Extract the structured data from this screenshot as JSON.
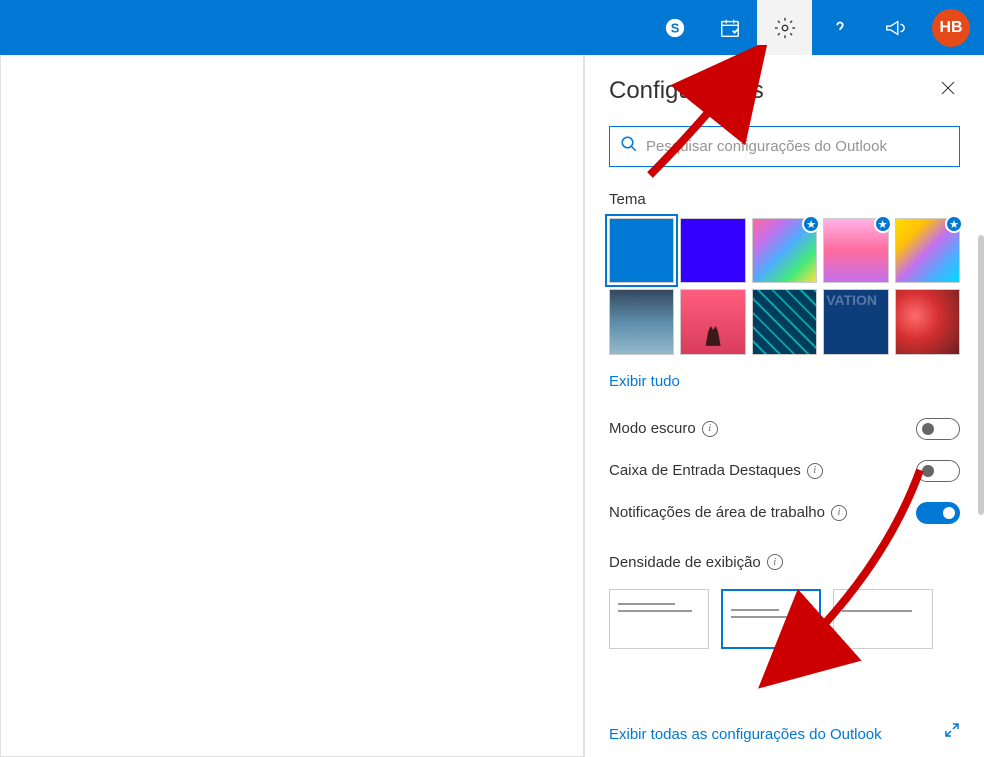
{
  "header": {
    "avatar_initials": "HB"
  },
  "settings": {
    "title": "Configurações",
    "search_placeholder": "Pesquisar configurações do Outlook",
    "theme_label": "Tema",
    "show_all_label": "Exibir tudo",
    "dark_mode_label": "Modo escuro",
    "focused_inbox_label": "Caixa de Entrada Destaques",
    "desktop_notifications_label": "Notificações de área de trabalho",
    "display_density_label": "Densidade de exibição",
    "footer_link": "Exibir todas as configurações do Outlook",
    "toggles": {
      "dark_mode": false,
      "focused_inbox": false,
      "desktop_notifications": true
    }
  }
}
